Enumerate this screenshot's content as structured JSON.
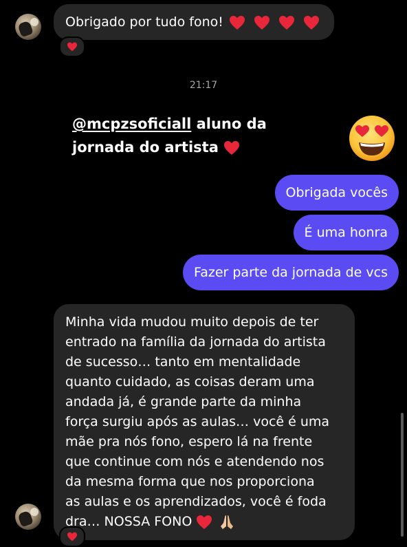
{
  "messages": {
    "first": {
      "text": "Obrigado por tudo fono! ",
      "hearts": 4,
      "reaction": "heart-reaction"
    },
    "timestamp": "21:17",
    "story_reply": {
      "mention": "@mcpzsoficiall",
      "text_line1": " aluno da",
      "text_line2": "jornada do artista ",
      "emoji": "heart-eyes-emoji"
    },
    "outgoing": [
      {
        "text": "Obrigada vocês"
      },
      {
        "text": "É uma honra"
      },
      {
        "text": "Fazer parte da jornada de vcs"
      }
    ],
    "long_message": {
      "lines": [
        "Minha vida mudou muito depois de ter",
        "entrado na família da jornada do artista",
        "de sucesso… tanto em mentalidade",
        "quanto cuidado, as coisas deram uma",
        "andada já, é grande parte da minha",
        "força surgiu após as aulas… você é uma",
        "mãe pra nós fono, espero lá na frente",
        "que continue com nós e atendendo nos",
        "da mesma forma que nos proporciona",
        "as aulas e os aprendizados, você é foda",
        "dra… NOSSA FONO "
      ],
      "trailing_emojis": [
        "heart",
        "praying-hands"
      ],
      "reaction": "heart-reaction"
    }
  },
  "colors": {
    "background": "#000000",
    "incoming_bubble": "#262626",
    "outgoing_bubble": "#5a4cf2",
    "heart": "#e8283a",
    "timestamp": "#a8a8a8"
  }
}
